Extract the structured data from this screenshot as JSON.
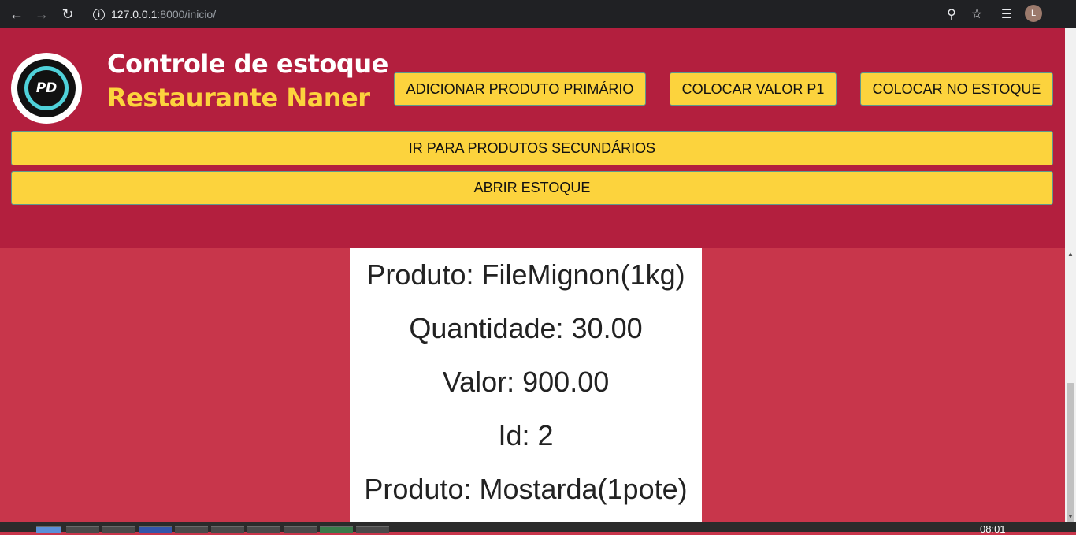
{
  "browser": {
    "url_host": "127.0.0.1",
    "url_path": ":8000/inicio/",
    "avatar_letter": "L",
    "icons": [
      "back-arrow-icon",
      "forward-arrow-icon",
      "reload-icon",
      "info-icon",
      "zoom-icon",
      "star-icon",
      "media-queue-icon"
    ]
  },
  "header": {
    "logo_text": "PD",
    "title": "Controle de estoque",
    "subtitle": "Restaurante Naner",
    "buttons": {
      "add_primary": "ADICIONAR PRODUTO PRIMÁRIO",
      "set_value": "COLOCAR VALOR P1",
      "add_stock": "COLOCAR NO ESTOQUE",
      "go_secondary": "IR PARA PRODUTOS SECUNDÁRIOS",
      "open_stock": "ABRIR ESTOQUE"
    }
  },
  "content": {
    "lines": [
      "Produto: FileMignon(1kg)",
      "Quantidade: 30.00",
      "Valor: 900.00",
      "Id: 2",
      "Produto: Mostarda(1pote)"
    ]
  },
  "taskbar": {
    "clock": "08:01"
  },
  "colors": {
    "header_bg": "#b31f3e",
    "page_bg": "#c8364b",
    "button_bg": "#fcd33d",
    "subtitle": "#fcd33d"
  }
}
